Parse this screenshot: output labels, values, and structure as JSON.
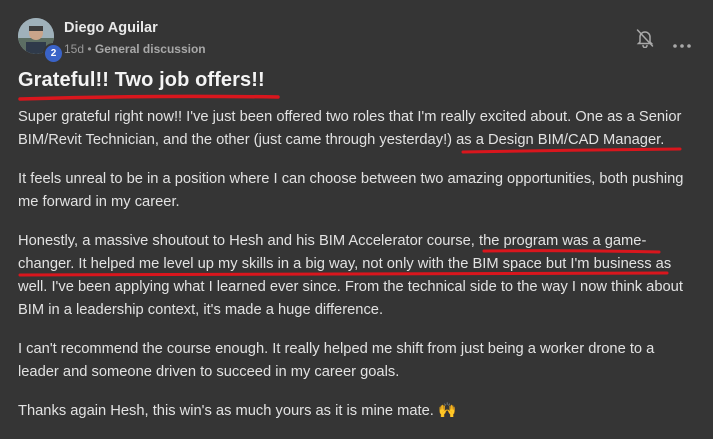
{
  "post": {
    "author": "Diego Aguilar",
    "level": "2",
    "time": "15d",
    "separator": " • ",
    "category": "General discussion",
    "title": "Grateful!! Two job offers!!",
    "p1a": "Super grateful right now!! I've just been offered two roles that I'm really excited about. One as a Senior BIM/Revit Technician, and the other (just came through yesterday!) ",
    "p1b": "as a Design BIM/CAD Manager.",
    "p2": "It feels unreal to be in a position where I can choose between two amazing opportunities, both pushing me forward in my career.",
    "p3a": "Honestly, a massive shoutout to Hesh and his BIM Accelerator course, ",
    "p3b": "the program was a game-changer. It helped me level up my skills in a big way, not only with the BIM space but I'm business as",
    "p3c": " well. I've been applying what I learned ever since. From the technical side to the way I now think about BIM in a leadership context, it's made a huge difference.",
    "p4": "I can't recommend the course enough. It really helped me shift from just being a worker drone to a leader and someone driven to succeed in my career goals.",
    "p5": "Thanks again Hesh, this win's as much yours as it is mine mate.",
    "emoji": "🙌"
  },
  "colors": {
    "background": "#353535",
    "underline": "#d9161d",
    "badge": "#3a63c7"
  },
  "icons": [
    "bell-off-icon",
    "more-options-icon"
  ]
}
